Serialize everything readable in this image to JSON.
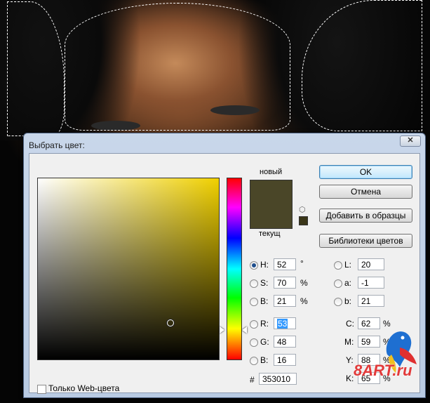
{
  "dialog": {
    "title": "Выбрать цвет:",
    "close_icon": "close-icon"
  },
  "swatch": {
    "new_label": "новый",
    "current_label": "текущ",
    "new_color": "#4a4628",
    "current_color": "#3a3618"
  },
  "buttons": {
    "ok": "OK",
    "cancel": "Отмена",
    "add_to_swatches": "Добавить в образцы",
    "color_libraries": "Библиотеки цветов"
  },
  "hsb": {
    "h_label": "H:",
    "h_value": "52",
    "h_unit": "°",
    "s_label": "S:",
    "s_value": "70",
    "s_unit": "%",
    "b_label": "B:",
    "b_value": "21",
    "b_unit": "%"
  },
  "rgb": {
    "r_label": "R:",
    "r_value": "53",
    "g_label": "G:",
    "g_value": "48",
    "b_label": "B:",
    "b_value": "16"
  },
  "lab": {
    "l_label": "L:",
    "l_value": "20",
    "a_label": "a:",
    "a_value": "-1",
    "b_label": "b:",
    "b_value": "21"
  },
  "cmyk": {
    "c_label": "C:",
    "c_value": "62",
    "c_unit": "%",
    "m_label": "M:",
    "m_value": "59",
    "m_unit": "%",
    "y_label": "Y:",
    "y_value": "88",
    "y_unit": "%",
    "k_label": "K:",
    "k_value": "65",
    "k_unit": "%"
  },
  "hex": {
    "label": "#",
    "value": "353010"
  },
  "web_only": {
    "label": "Только Web-цвета",
    "checked": false
  },
  "watermark": "8ART.ru"
}
